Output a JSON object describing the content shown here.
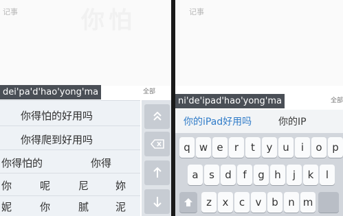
{
  "left": {
    "note_title": "记事",
    "watermark": "你怕",
    "pinyin": "dei'pa'd'hao'yong'ma",
    "all_label": "全部",
    "candidates": [
      [
        "你得怕的好用吗"
      ],
      [
        "你得爬到好用吗"
      ],
      [
        "你得怕的",
        "你得"
      ],
      [
        "你",
        "呢",
        "尼",
        "妳"
      ],
      [
        "妮",
        "你",
        "腻",
        "泥"
      ]
    ],
    "side_keys": [
      "up-chevron-icon",
      "backspace-icon",
      "up-arrow-icon",
      "down-arrow-icon"
    ]
  },
  "right": {
    "note_title": "记事",
    "pinyin": "ni'de'ipad'hao'yong'ma",
    "all_label": "全部",
    "candidates": [
      "你的iPad好用吗",
      "你的IP"
    ],
    "keys": {
      "row1": [
        "q",
        "w",
        "e",
        "r",
        "t",
        "y",
        "u",
        "i",
        "o",
        "p"
      ],
      "row2": [
        "a",
        "s",
        "d",
        "f",
        "g",
        "h",
        "j",
        "k",
        "l"
      ],
      "row3": [
        "z",
        "x",
        "c",
        "v",
        "b",
        "n",
        "m"
      ],
      "shift_icon": "shift-arrow-icon"
    }
  }
}
